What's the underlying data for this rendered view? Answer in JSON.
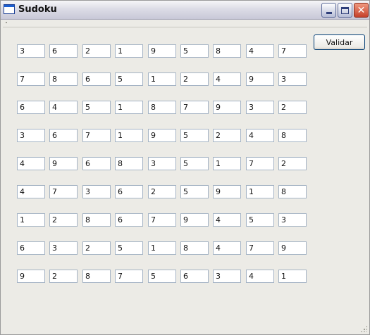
{
  "window": {
    "title": "Sudoku",
    "close_glyph": "✕"
  },
  "actions": {
    "validate_label": "Validar"
  },
  "grid": [
    [
      "3",
      "6",
      "2",
      "1",
      "9",
      "5",
      "8",
      "4",
      "7"
    ],
    [
      "7",
      "8",
      "6",
      "5",
      "1",
      "2",
      "4",
      "9",
      "3"
    ],
    [
      "6",
      "4",
      "5",
      "1",
      "8",
      "7",
      "9",
      "3",
      "2"
    ],
    [
      "3",
      "6",
      "7",
      "1",
      "9",
      "5",
      "2",
      "4",
      "8"
    ],
    [
      "4",
      "9",
      "6",
      "8",
      "3",
      "5",
      "1",
      "7",
      "2"
    ],
    [
      "4",
      "7",
      "3",
      "6",
      "2",
      "5",
      "9",
      "1",
      "8"
    ],
    [
      "1",
      "2",
      "8",
      "6",
      "7",
      "9",
      "4",
      "5",
      "3"
    ],
    [
      "6",
      "3",
      "2",
      "5",
      "1",
      "8",
      "4",
      "7",
      "9"
    ],
    [
      "9",
      "2",
      "8",
      "7",
      "5",
      "6",
      "3",
      "4",
      "1"
    ]
  ],
  "icons": {
    "app": "window-icon",
    "minimize": "minimize-icon",
    "maximize": "maximize-icon",
    "close": "close-icon"
  }
}
